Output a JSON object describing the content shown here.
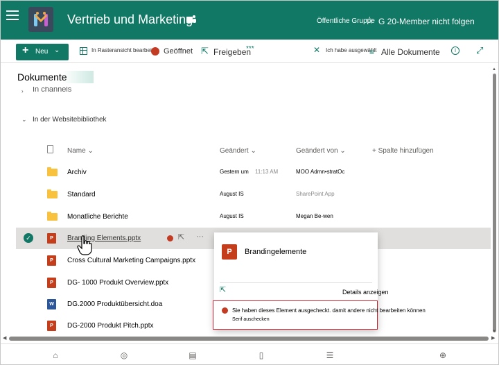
{
  "header": {
    "site_title": "Vertrieb und Marketing",
    "group_type": "Öffentliche Gruppe",
    "follow_label": "G 20-Member nicht folgen",
    "brand_color": "#117865"
  },
  "commandbar": {
    "new_label": "Neu",
    "grid_view_label": "In Rasteransicht bearbeiten",
    "checkout_label": "Geöffnet",
    "share_label": "Freigeben",
    "more_label": "***",
    "selected_label": "Ich habe ausgewählt",
    "view_label": "Alle Dokumente",
    "info_label": "i"
  },
  "library": {
    "title": "Dokumente",
    "in_channels": "In channels",
    "site_library": "In der Websitebibliothek"
  },
  "columns": {
    "name": "Name",
    "modified": "Geändert",
    "modified_by": "Geändert von",
    "add_column": "+ Spalte hinzufügen"
  },
  "rows": [
    {
      "name": "Archiv",
      "modified": "Gestern um",
      "time": "11:13 AM",
      "by": "MOO Admn•stratOc",
      "type": "folder"
    },
    {
      "name": "Standard",
      "modified": "August IS",
      "time": "",
      "by": "SharePoint App",
      "type": "folder"
    },
    {
      "name": "Monatliche Berichte",
      "modified": "August IS",
      "time": "",
      "by": "Megan Be-wen",
      "type": "folder"
    },
    {
      "name": "Branding Elements.pptx",
      "modified": "",
      "time": "",
      "by": "",
      "type": "pptx"
    },
    {
      "name": "Cross Cultural Marketing Campaigns.pptx",
      "modified": "",
      "time": "",
      "by": "",
      "type": "pptx"
    },
    {
      "name": "DG- 1000 Produkt Overview.pptx",
      "modified": "",
      "time": "",
      "by": "",
      "type": "pptx"
    },
    {
      "name": "DG.2000 Produktübersicht.doa",
      "modified": "",
      "time": "",
      "by": "",
      "type": "docx"
    },
    {
      "name": "DG-2000 Produkt Pitch.pptx",
      "modified": "",
      "time": "",
      "by": "",
      "type": "pptx"
    }
  ],
  "file_icons": {
    "pptx": "P",
    "docx": "W"
  },
  "popup": {
    "title": "Brandingelemente",
    "details_label": "Details anzeigen",
    "alert_text": "Sie haben dieses Element ausgecheckt. damit andere nicht bearbeiten können",
    "alert_link": "Serif auschecken"
  }
}
